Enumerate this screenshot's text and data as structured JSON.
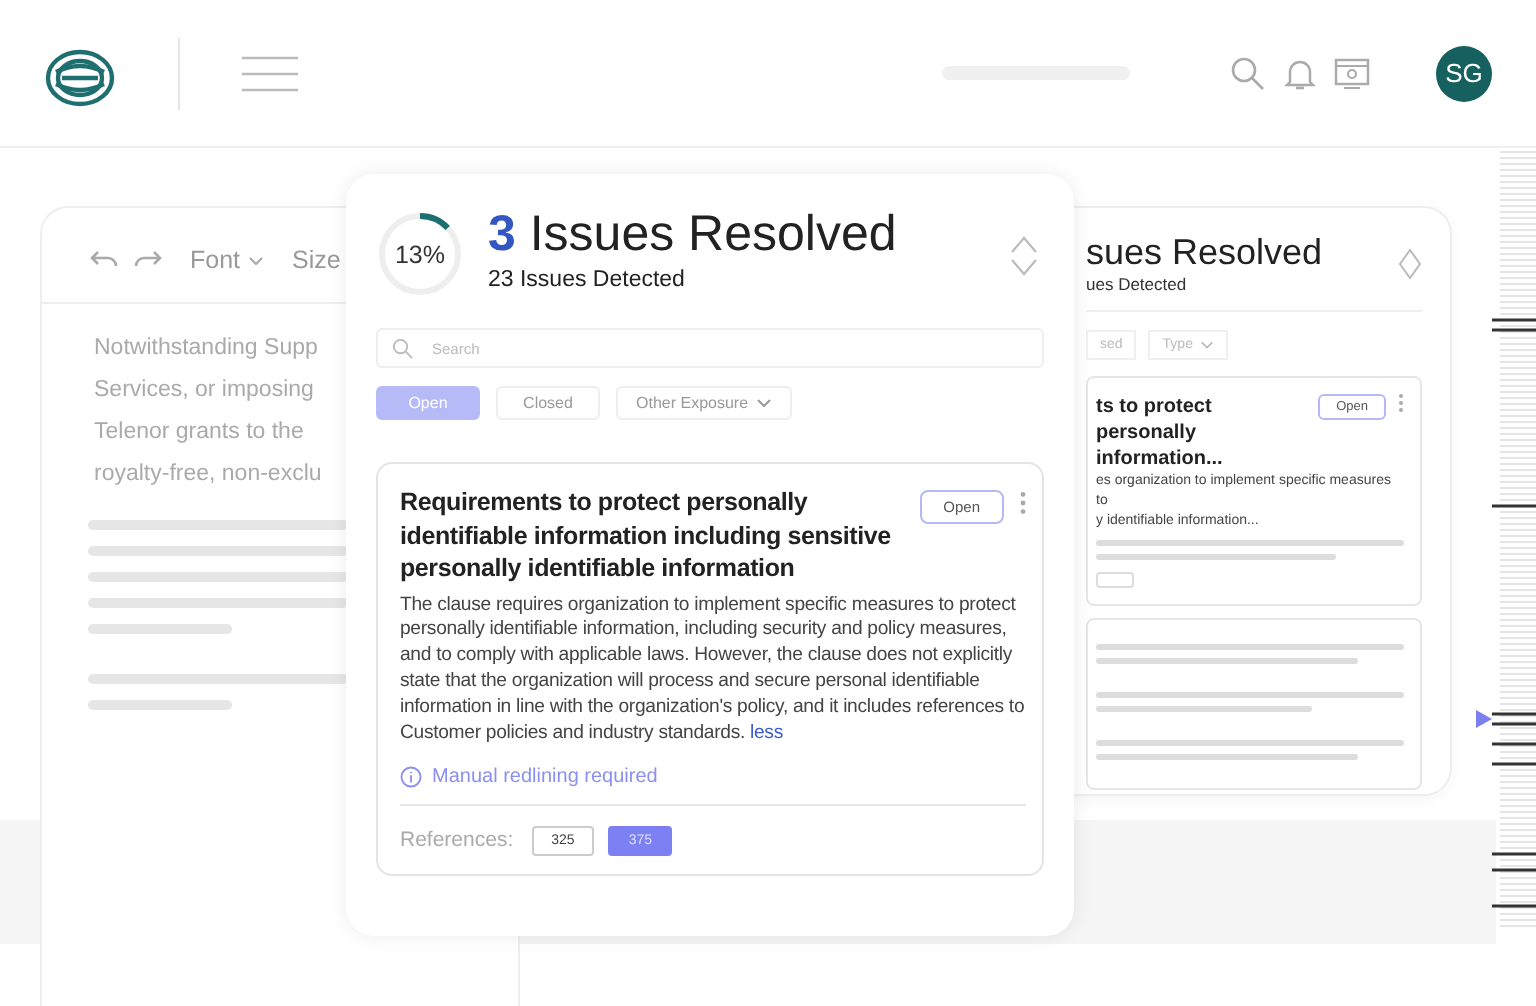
{
  "header": {
    "avatar_initials": "SG"
  },
  "editor": {
    "toolbar": {
      "font": "Font",
      "size": "Size"
    },
    "text_lines": [
      "Notwithstanding Supp",
      "Services, or imposing",
      "Telenor grants to the",
      "royalty-free, non-exclu"
    ]
  },
  "back_panel": {
    "title": "sues Resolved",
    "subtitle": "ues Detected",
    "filters": [
      {
        "label": "sed",
        "has_menu": false
      },
      {
        "label": "Type",
        "has_menu": true
      }
    ],
    "issue": {
      "title_lines": [
        "ts to protect personally",
        "information..."
      ],
      "status": "Open",
      "description_lines": [
        "es organization to implement specific measures to",
        "y identifiable information..."
      ]
    }
  },
  "issues_panel": {
    "progress": {
      "label": "13%",
      "level": 0.13
    },
    "resolved_count": "3",
    "resolved_label": "Issues Resolved",
    "detected": "23 Issues Detected",
    "search": {
      "placeholder": "Search"
    },
    "filters": [
      {
        "label": "Open",
        "selected": true,
        "has_menu": false
      },
      {
        "label": "Closed",
        "selected": false,
        "has_menu": false
      },
      {
        "label": "Other Exposure",
        "selected": false,
        "has_menu": true
      }
    ],
    "issue": {
      "title": "Requirements to protect personally identifiable information including sensitive personally identifiable information",
      "status": "Open",
      "description": "The clause requires organization to implement specific measures to protect personally identifiable information, including security and policy measures, and to comply with applicable laws. However, the clause does not explicitly state that the organization will process and secure personal identifiable information in line with the organization's policy, and it includes references to Customer policies and industry standards.",
      "more_link": "less",
      "note": "Manual redlining required",
      "references_label": "References:",
      "references": [
        {
          "label": "325",
          "selected": false
        },
        {
          "label": "375",
          "selected": true
        }
      ]
    }
  }
}
